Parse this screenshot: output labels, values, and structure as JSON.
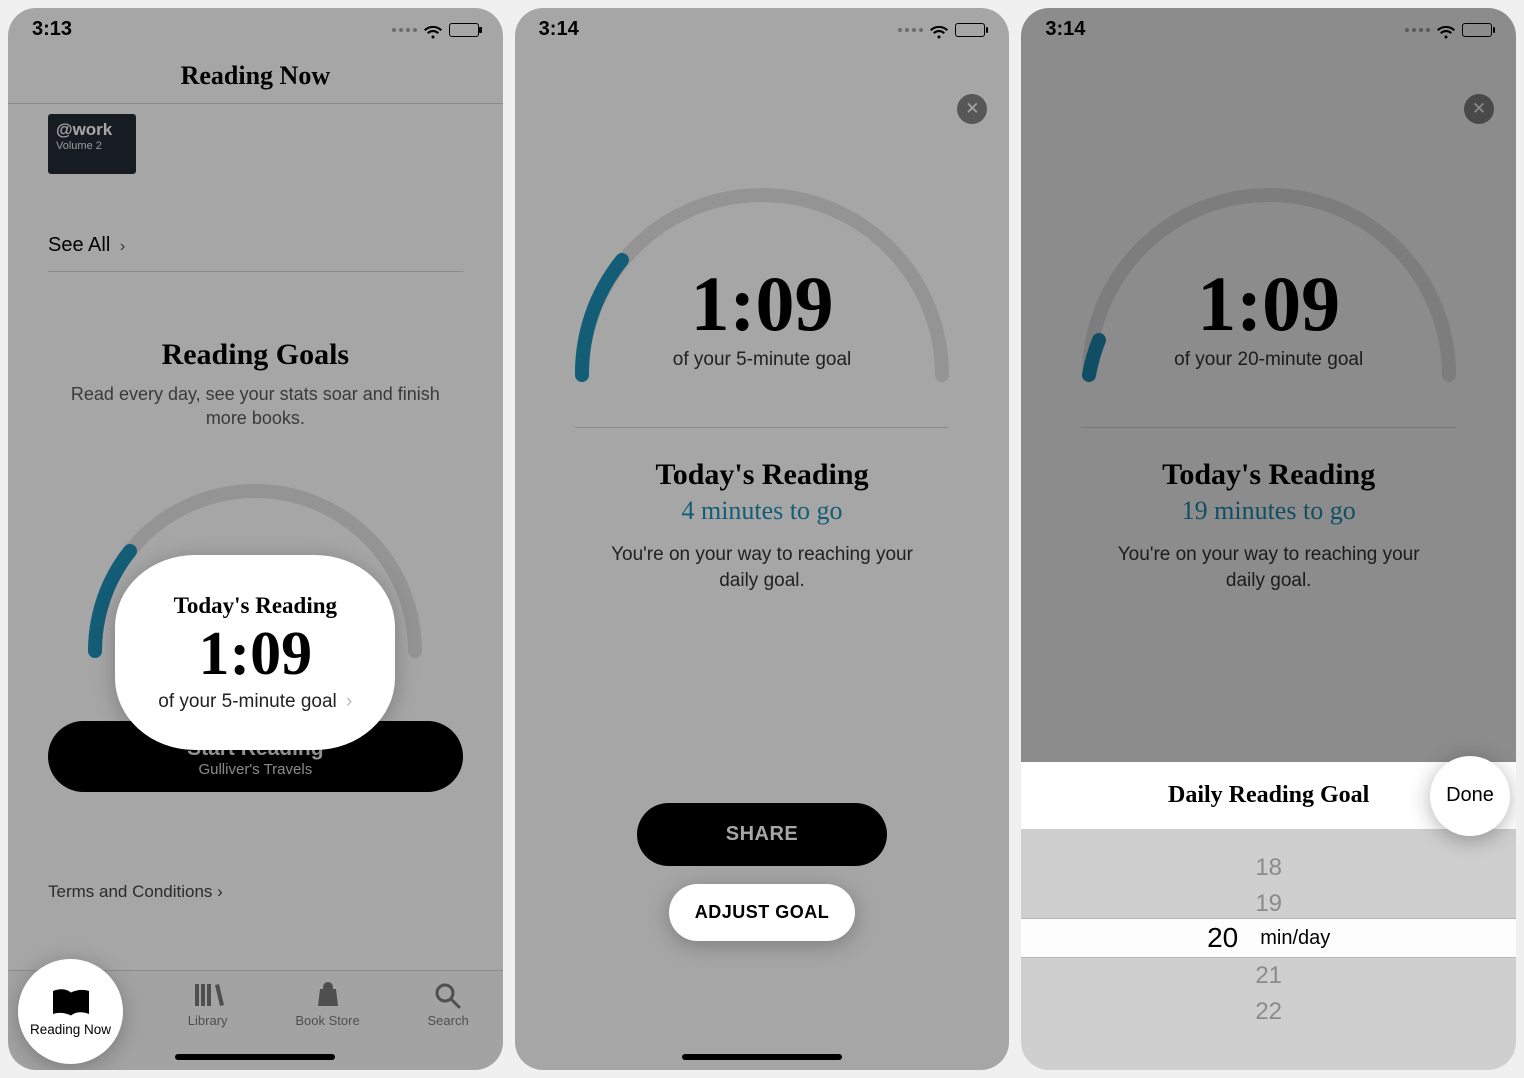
{
  "pane1": {
    "status_time": "3:13",
    "nav_title": "Reading Now",
    "book_thumb_title": "@work",
    "book_thumb_sub": "Volume 2",
    "see_all": "See All",
    "goals_header": "Reading Goals",
    "goals_sub": "Read every day, see your stats soar and finish more books.",
    "card_today": "Today's Reading",
    "card_time": "1:09",
    "card_goal": "of your 5-minute goal",
    "start_title": "Start Reading",
    "start_sub": "Gulliver's Travels",
    "terms": "Terms and Conditions",
    "tabs": {
      "reading_now": "Reading Now",
      "library": "Library",
      "book_store": "Book Store",
      "search": "Search"
    }
  },
  "pane2": {
    "status_time": "3:14",
    "time": "1:09",
    "goal_sub": "of your 5-minute goal",
    "today_h": "Today's Reading",
    "mins_to_go": "4 minutes to go",
    "encourage": "You're on your way to reaching your daily goal.",
    "share": "SHARE",
    "adjust": "ADJUST GOAL"
  },
  "pane3": {
    "status_time": "3:14",
    "time": "1:09",
    "goal_sub": "of your 20-minute goal",
    "today_h": "Today's Reading",
    "mins_to_go": "19 minutes to go",
    "encourage": "You're on your way to reaching your daily goal.",
    "sheet_title": "Daily Reading Goal",
    "done": "Done",
    "picker": {
      "items": [
        "18",
        "19",
        "20",
        "21",
        "22"
      ],
      "selected": "20",
      "unit": "min/day"
    }
  }
}
